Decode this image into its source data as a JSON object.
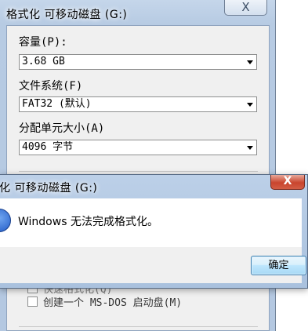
{
  "format_dialog": {
    "title": "格式化 可移动磁盘 (G:)",
    "close_glyph": "X",
    "capacity_label": "容量(P):",
    "capacity_value": "3.68 GB",
    "filesystem_label": "文件系统(F)",
    "filesystem_value": "FAT32 (默认)",
    "allocation_label": "分配单元大小(A)",
    "allocation_value": "4096 字节",
    "partial_option": "快速格式化(Q)",
    "msdos_option": "创建一个 MS-DOS 启动盘(M)"
  },
  "message_box": {
    "title": "化 可移动磁盘 (G:)",
    "close_glyph": "X",
    "message": "Windows 无法完成格式化。",
    "icon": "info-icon",
    "ok_label": "确定"
  },
  "colors": {
    "title_bar": "#b7cbe3",
    "close_red": "#c9452e",
    "button_blue": "#3c7fb1"
  }
}
